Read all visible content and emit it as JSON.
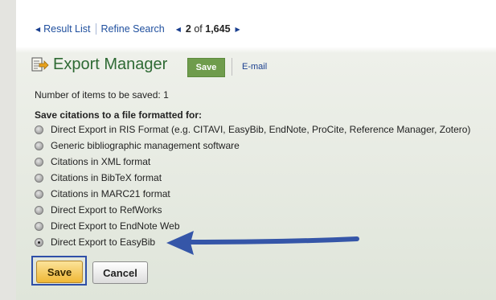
{
  "nav": {
    "result_list": "Result List",
    "refine_search": "Refine Search",
    "current": "2",
    "of_text": "of",
    "total": "1,645"
  },
  "header": {
    "title": "Export Manager",
    "save_label": "Save",
    "email_label": "E-mail"
  },
  "items_count_text": "Number of items to be saved: 1",
  "section_heading": "Save citations to a file formatted for:",
  "options": [
    {
      "label": "Direct Export in RIS Format (e.g. CITAVI, EasyBib, EndNote, ProCite, Reference Manager, Zotero)",
      "selected": false
    },
    {
      "label": "Generic bibliographic management software",
      "selected": false
    },
    {
      "label": "Citations in XML format",
      "selected": false
    },
    {
      "label": "Citations in BibTeX format",
      "selected": false
    },
    {
      "label": "Citations in MARC21 format",
      "selected": false
    },
    {
      "label": "Direct Export to RefWorks",
      "selected": false
    },
    {
      "label": "Direct Export to EndNote Web",
      "selected": false
    },
    {
      "label": "Direct Export to EasyBib",
      "selected": true
    }
  ],
  "buttons": {
    "save": "Save",
    "cancel": "Cancel"
  },
  "colors": {
    "title_green": "#2e6a34",
    "save_green": "#6f9c4c",
    "link_blue": "#1a3f8f",
    "annotation_blue": "#3556a8",
    "save_gold": "#f0b836"
  },
  "icons": {
    "title": "export-document-icon",
    "nav_prev": "triangle-left-icon",
    "nav_next": "triangle-right-icon",
    "annotation": "annotation-arrow-icon"
  }
}
